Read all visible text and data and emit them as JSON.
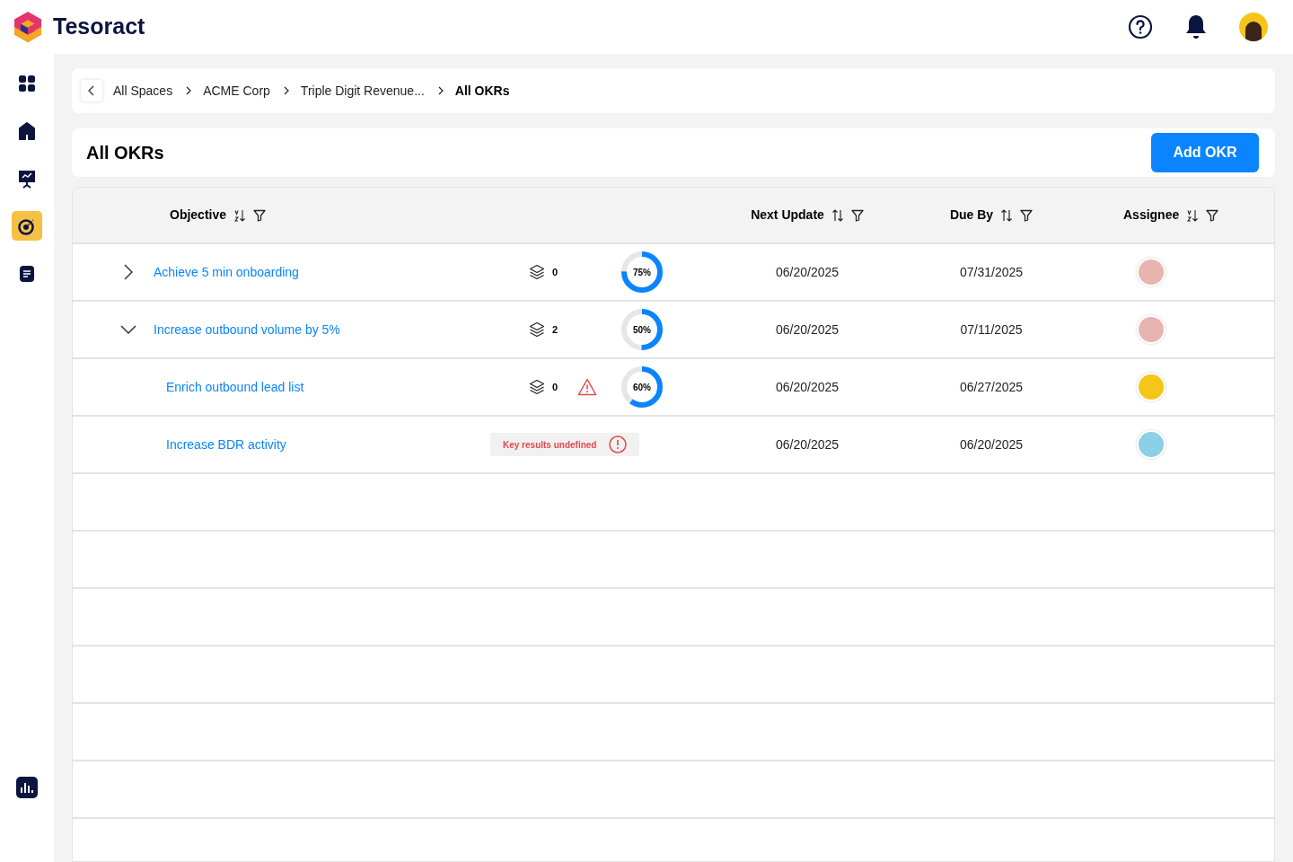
{
  "brand": {
    "name": "Tesoract"
  },
  "sidebar": {
    "items": [
      {
        "selected": false
      },
      {
        "selected": false
      },
      {
        "selected": false
      },
      {
        "selected": true
      },
      {
        "selected": false
      }
    ]
  },
  "breadcrumb": [
    {
      "label": "All Spaces",
      "current": false
    },
    {
      "label": "ACME Corp",
      "current": false
    },
    {
      "label": "Triple Digit Revenue...",
      "current": false
    },
    {
      "label": "All OKRs",
      "current": true
    }
  ],
  "page": {
    "title": "All OKRs",
    "add_button": "Add OKR"
  },
  "table": {
    "columns": [
      {
        "label": "Objective",
        "kind": "alpha"
      },
      {
        "label": "Next Update",
        "kind": "updown"
      },
      {
        "label": "Due By",
        "kind": "updown"
      },
      {
        "label": "Assignee",
        "kind": "alpha"
      }
    ],
    "rows": [
      {
        "title": "Achieve 5 min onboarding",
        "expanded": false,
        "key_results": "0",
        "warning": false,
        "progress": {
          "level": 0.75,
          "label": "75%"
        },
        "next_update": "06/20/2025",
        "due_by": "07/31/2025",
        "color": "#e8b4b0",
        "children": []
      },
      {
        "title": "Increase outbound volume by 5%",
        "expanded": true,
        "key_results": "2",
        "warning": false,
        "progress": {
          "level": 0.5,
          "label": "50%"
        },
        "next_update": "06/20/2025",
        "due_by": "07/11/2025",
        "color": "#e8b4b0",
        "children": [
          {
            "title": "Enrich outbound lead list",
            "key_results": "0",
            "warning": true,
            "progress": {
              "level": 0.6,
              "label": "60%"
            },
            "next_update": "06/20/2025",
            "due_by": "06/27/2025",
            "color": "#f5c518"
          },
          {
            "title": "Increase BDR activity",
            "badge": "Key results undefined",
            "next_update": "06/20/2025",
            "due_by": "06/20/2025",
            "color": "#8ccfe6"
          }
        ]
      }
    ]
  }
}
